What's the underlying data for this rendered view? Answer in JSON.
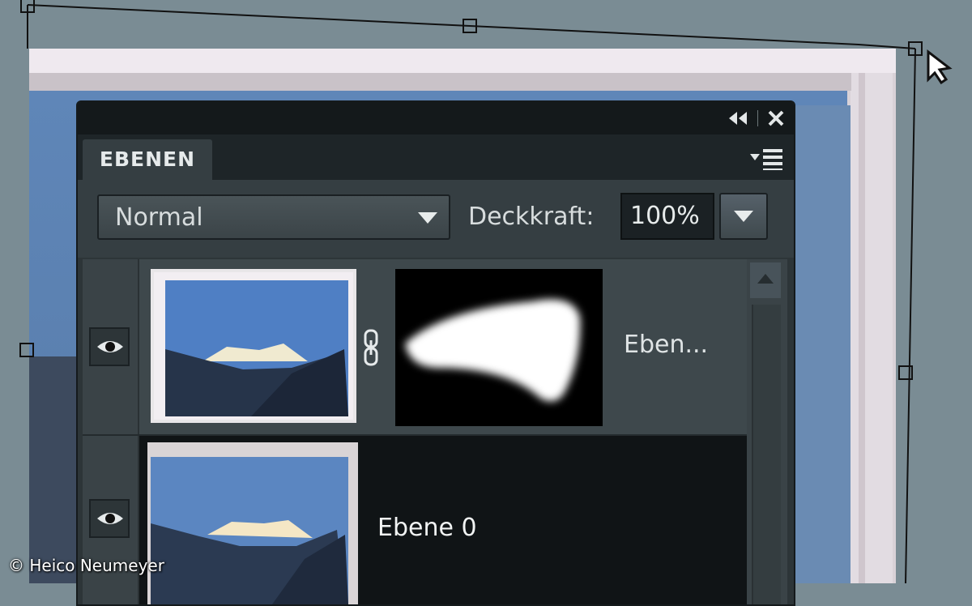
{
  "panel": {
    "tab_label": "EBENEN",
    "collapse_icon": "double-chevron-left-icon",
    "close_icon": "close-icon",
    "menu_icon": "panel-menu-icon"
  },
  "options": {
    "blend_mode": "Normal",
    "opacity_label": "Deckkraft:",
    "opacity_value": "100%"
  },
  "layers": [
    {
      "name": "Eben...",
      "visible": true,
      "has_mask": true
    },
    {
      "name": "Ebene 0",
      "visible": true,
      "selected": true
    }
  ],
  "credit": "© Heico Neumeyer",
  "colors": {
    "panel_bg": "#2d3538",
    "titlebar_bg": "#14191b",
    "selected_row_bg": "#101416",
    "canvas_bg": "#7a8c94"
  }
}
